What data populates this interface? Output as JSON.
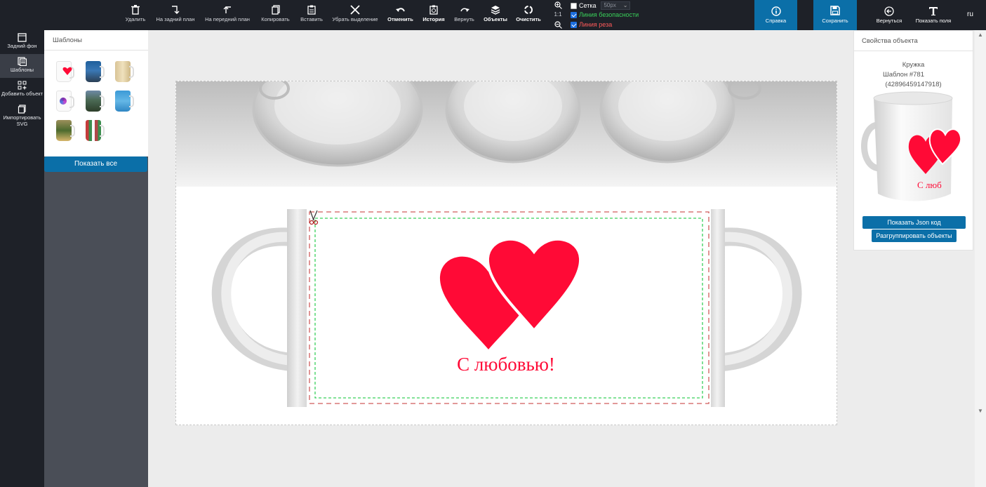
{
  "toolbar": {
    "delete": "Удалить",
    "send_back": "На задний план",
    "bring_front": "На передний план",
    "copy": "Копировать",
    "paste": "Вставить",
    "deselect": "Убрать выделение",
    "undo": "Отменить",
    "history": "История",
    "redo": "Вернуть",
    "objects": "Объекты",
    "clear": "Очистить",
    "zoom_ratio": "1:1",
    "grid_label": "Сетка",
    "grid_size": "50px",
    "safety_line": "Линия безопасности",
    "cut_line": "Линия реза",
    "help": "Справка",
    "save": "Сохранить",
    "back": "Вернуться",
    "show_fields": "Показать поля",
    "lang": "ru"
  },
  "colors": {
    "accent": "#0b6fa8",
    "safety_line": "#39d05a",
    "cut_line": "#ff5a5a",
    "heart": "#ff0a36"
  },
  "sidebar": {
    "background": "Задний фон",
    "templates": "Шаблоны",
    "add_object": "Добавить объект",
    "import_svg_1": "Импортировать",
    "import_svg_2": "SVG"
  },
  "templates_panel": {
    "title": "Шаблоны",
    "show_all": "Показать все"
  },
  "canvas": {
    "caption": "С любовью!"
  },
  "properties": {
    "title": "Свойства объекта",
    "object_type": "Кружка",
    "template_name": "Шаблон #781",
    "template_code": "(42896459147918)",
    "mug_caption": "С люб",
    "show_json": "Показать Json код",
    "ungroup": "Разгруппировать объекты"
  }
}
